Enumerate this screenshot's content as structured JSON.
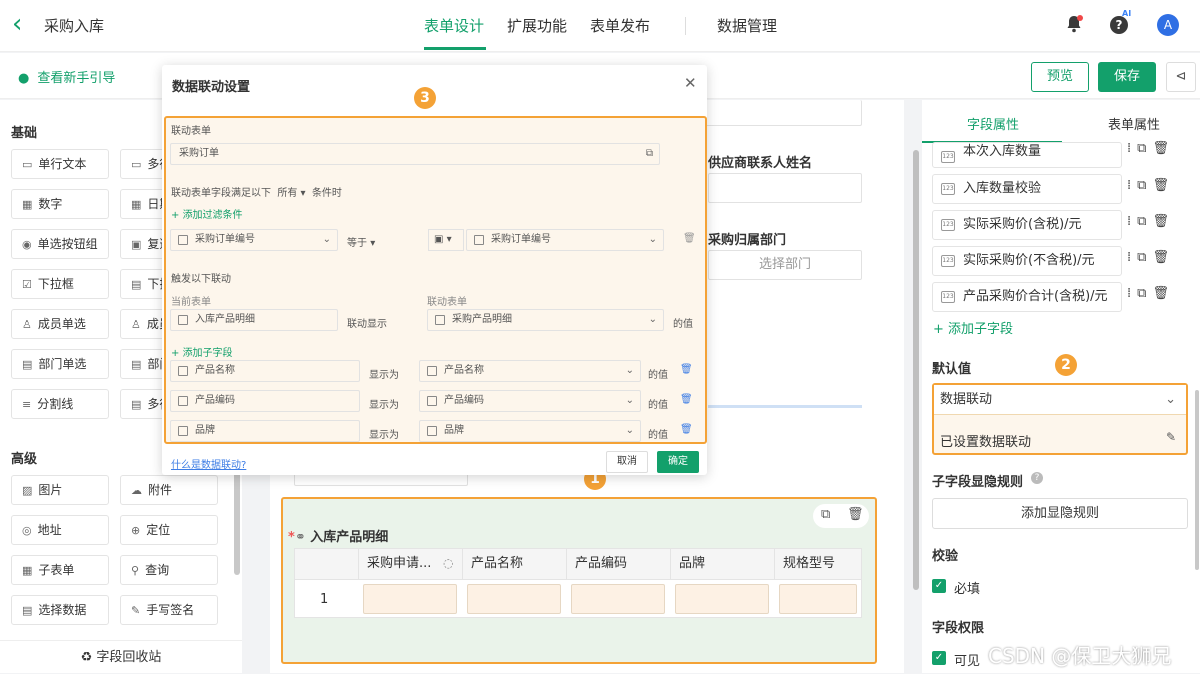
{
  "topbar": {
    "title": "采购入库",
    "tabs": [
      "表单设计",
      "扩展功能",
      "表单发布",
      "数据管理"
    ],
    "ai_label": "AI",
    "avatar": "A"
  },
  "toolbar": {
    "guide": "查看新手引导",
    "preview": "预览",
    "save": "保存"
  },
  "left": {
    "basic_title": "基础",
    "basic": [
      [
        "单行文本",
        "多行文本"
      ],
      [
        "数字",
        "日期"
      ],
      [
        "单选按钮组",
        "复选框组"
      ],
      [
        "下拉框",
        "下拉复选框"
      ],
      [
        "成员单选",
        "成员多选"
      ],
      [
        "部门单选",
        "部门多选"
      ],
      [
        "分割线",
        "多行文本"
      ]
    ],
    "basic_trunc": [
      [
        "单行文本",
        "多行"
      ],
      [
        "数字",
        "日期"
      ],
      [
        "单选按钮组",
        "复选"
      ],
      [
        "下拉框",
        "下拉"
      ],
      [
        "成员单选",
        "成员"
      ],
      [
        "部门单选",
        "部门"
      ],
      [
        "分割线",
        "多行"
      ]
    ],
    "adv_title": "高级",
    "advanced": [
      [
        "图片",
        "附件"
      ],
      [
        "地址",
        "定位"
      ],
      [
        "子表单",
        "查询"
      ],
      [
        "选择数据",
        "手写签名"
      ]
    ],
    "recycle": "字段回收站"
  },
  "canvas": {
    "supplier_contact": "供应商联系人姓名",
    "purchase_dept": "采购归属部门",
    "dept_placeholder": "选择部门",
    "subtable_title": "入库产品明细",
    "columns": [
      "采购申请...",
      "产品名称",
      "产品编码",
      "品牌",
      "规格型号"
    ],
    "row_index": "1"
  },
  "right": {
    "tabs": [
      "字段属性",
      "表单属性"
    ],
    "fields": [
      "本次入库数量",
      "入库数量校验",
      "实际采购价(含税)/元",
      "实际采购价(不含税)/元",
      "产品采购价合计(含税)/元"
    ],
    "add_sub": "添加子字段",
    "default_label": "默认值",
    "default_select": "数据联动",
    "linked_status": "已设置数据联动",
    "visibility_label": "子字段显隐规则",
    "add_visibility": "添加显隐规则",
    "validation_label": "校验",
    "required": "必填",
    "permission_label": "字段权限",
    "visible": "可见"
  },
  "badges": [
    "1",
    "2",
    "3"
  ],
  "dialog": {
    "title": "数据联动设置",
    "link_form_label": "联动表单",
    "link_form_value": "采购订单",
    "cond_prefix": "联动表单字段满足以下",
    "cond_mode": "所有",
    "cond_suffix": "条件时",
    "add_filter": "添加过滤条件",
    "filter_field": "采购订单编号",
    "filter_op": "等于",
    "filter_value": "采购订单编号",
    "trigger_label": "触发以下联动",
    "current_form_label": "当前表单",
    "link_form_label2": "联动表单",
    "current_form_value": "入库产品明细",
    "link_show": "联动显示",
    "linked_form_value": "采购产品明细",
    "value_suffix": "的值",
    "add_sub_field": "添加子字段",
    "show_as": "显示为",
    "mappings": [
      [
        "产品名称",
        "产品名称"
      ],
      [
        "产品编码",
        "产品编码"
      ],
      [
        "品牌",
        "品牌"
      ]
    ],
    "help_link": "什么是数据联动?",
    "cancel": "取消",
    "confirm": "确定"
  },
  "watermark": "CSDN @保卫大狮兄",
  "colors": {
    "accent": "#13a06b",
    "highlight": "#f4a236",
    "link": "#3d7de5"
  }
}
